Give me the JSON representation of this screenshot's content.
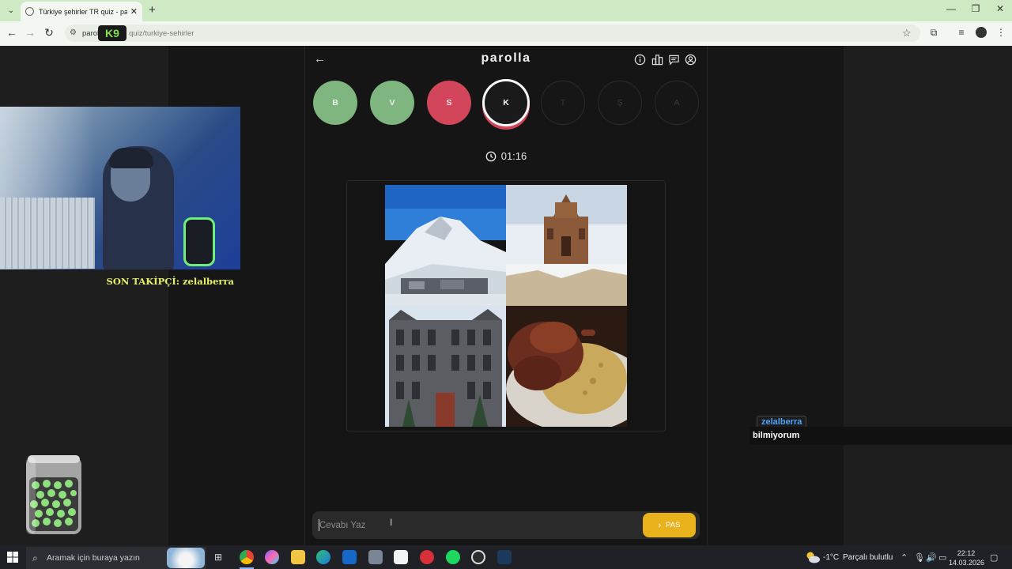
{
  "browser": {
    "tab_title": "Türkiye şehirler ТR quiz - parolla",
    "tab_close": "✕",
    "new_tab": "+",
    "url_host": "parol",
    "url_path": "quiz/turkiye-sehirler",
    "overlay_badge": "K9"
  },
  "app": {
    "brand": "parolla",
    "letters": [
      {
        "char": "B",
        "state": "correct"
      },
      {
        "char": "V",
        "state": "correct"
      },
      {
        "char": "S",
        "state": "wrong"
      },
      {
        "char": "K",
        "state": "active"
      },
      {
        "char": "T",
        "state": "pending"
      },
      {
        "char": "Ş",
        "state": "pending"
      },
      {
        "char": "A",
        "state": "pending"
      }
    ],
    "timer": "01:16",
    "answer_placeholder": "Cevabı Yaz",
    "pass_label": "PAS"
  },
  "stream": {
    "last_follower": "SON TAKİPÇİ: zelalberra",
    "chat_user": "zelalberra",
    "chat_message": "bilmiyorum"
  },
  "taskbar": {
    "search_placeholder": "Aramak için buraya yazın",
    "weather_temp": "-1°C",
    "weather_desc": "Parçalı bulutlu",
    "time": "22:12",
    "date": "14.03.2026"
  },
  "colors": {
    "correct": "#7fb57e",
    "wrong": "#d2455a",
    "accent_pass": "#e9b21d",
    "browser_frame": "#cfe9c4"
  }
}
